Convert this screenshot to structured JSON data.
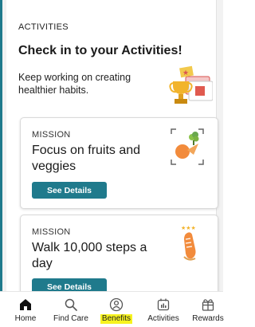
{
  "section_label": "ACTIVITIES",
  "headline": "Check in to your Activities!",
  "subtitle": "Keep working on creating healthier habits.",
  "cards": [
    {
      "label": "MISSION",
      "title": "Focus on fruits and veggies",
      "button_label": "See Details",
      "icon": "fruits-veggies-icon"
    },
    {
      "label": "MISSION",
      "title": "Walk 10,000 steps a day",
      "button_label": "See Details",
      "icon": "shoe-steps-icon"
    }
  ],
  "tabs": [
    {
      "label": "Home",
      "icon": "home-icon"
    },
    {
      "label": "Find Care",
      "icon": "search-icon"
    },
    {
      "label": "Benefits",
      "icon": "person-icon",
      "highlighted": true
    },
    {
      "label": "Activities",
      "icon": "calendar-icon"
    },
    {
      "label": "Rewards",
      "icon": "gift-icon"
    }
  ],
  "colors": {
    "accent": "#1f7a8c",
    "highlight": "#f7f31f",
    "text": "#222222"
  }
}
